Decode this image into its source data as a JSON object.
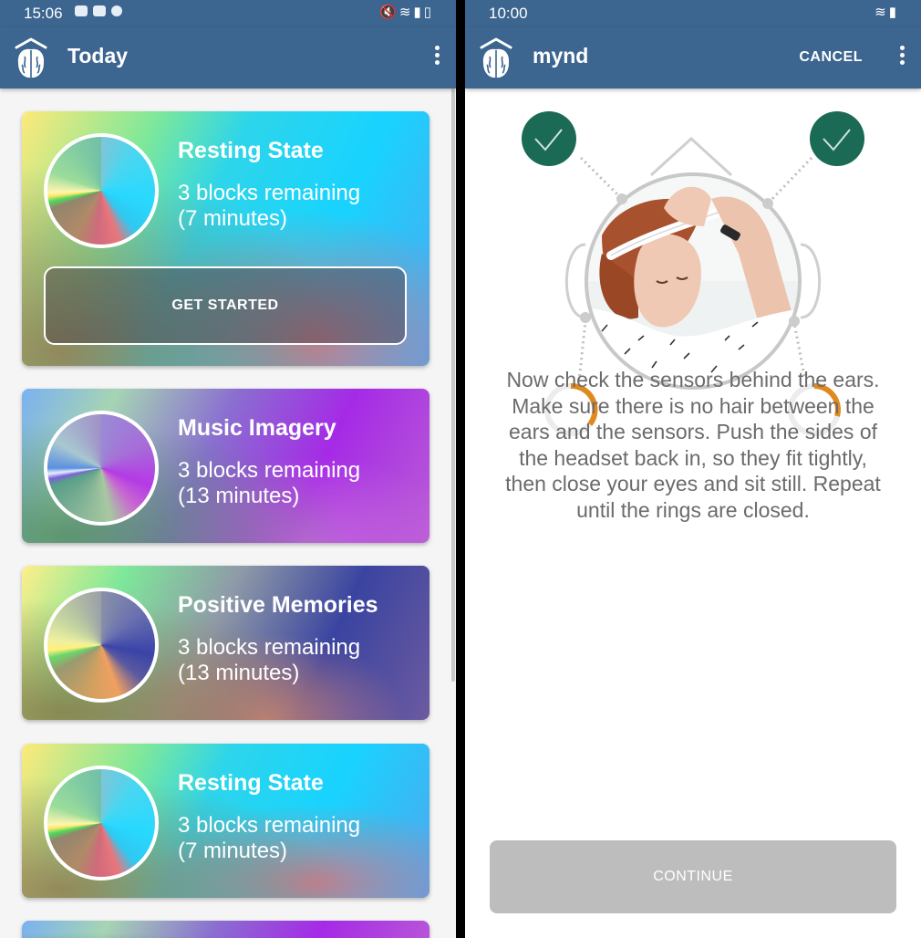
{
  "left_screen": {
    "status_bar": {
      "time": "15:06"
    },
    "app_bar": {
      "title": "Today"
    },
    "cards": [
      {
        "title": "Resting State",
        "line1": "3 blocks remaining",
        "line2": "(7 minutes)",
        "button": "GET STARTED",
        "theme": "cyan"
      },
      {
        "title": "Music Imagery",
        "line1": "3 blocks remaining",
        "line2": "(13 minutes)",
        "theme": "purple"
      },
      {
        "title": "Positive Memories",
        "line1": "3 blocks remaining",
        "line2": "(13 minutes)",
        "theme": "navy"
      },
      {
        "title": "Resting State",
        "line1": "3 blocks remaining",
        "line2": "(7 minutes)",
        "theme": "cyan"
      }
    ]
  },
  "right_screen": {
    "status_bar": {
      "time": "10:00"
    },
    "app_bar": {
      "title": "mynd",
      "cancel_label": "CANCEL"
    },
    "sensors": [
      {
        "position": "top-left",
        "state": "connected"
      },
      {
        "position": "top-right",
        "state": "connected"
      },
      {
        "position": "bottom-left",
        "state": "partial",
        "ring_fill": 0.35
      },
      {
        "position": "bottom-right",
        "state": "partial",
        "ring_fill": 0.3
      }
    ],
    "instructions": "Now check the sensors behind the ears. Make sure there is no hair between the ears and the sensors. Push the sides of the headset back in, so they fit tightly, then close your eyes and sit still. Repeat until the rings are closed.",
    "continue_label": "CONTINUE"
  },
  "colors": {
    "app_bar": "#3c6590",
    "sensor_connected": "#1a6a55",
    "sensor_ring": "#e08a1e",
    "continue_disabled": "#bdbdbd",
    "instruction_text": "#6b6b6b"
  },
  "icons": [
    "brain-logo-icon",
    "overflow-menu-icon",
    "checkmark-icon",
    "wifi-icon",
    "battery-icon",
    "signal-icon",
    "mute-icon"
  ]
}
